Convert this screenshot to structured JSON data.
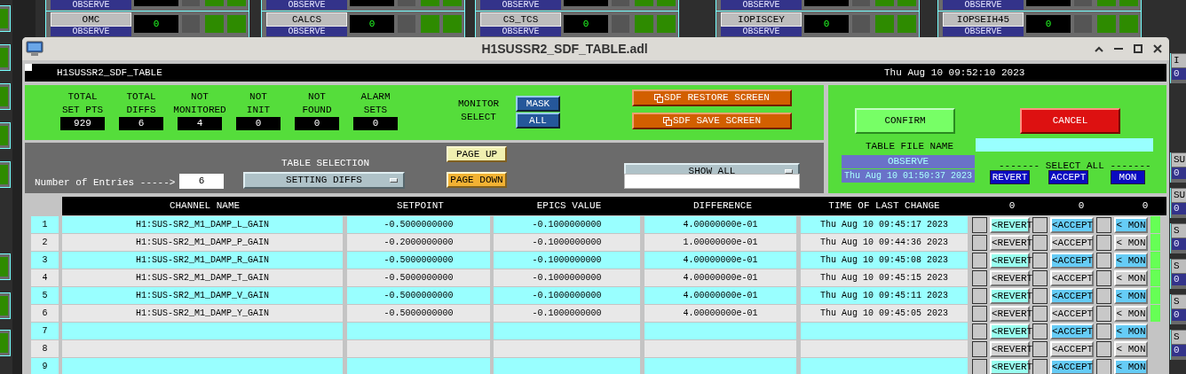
{
  "desktop": {
    "top_tiles": [
      {
        "status": "OBSERVE"
      },
      {
        "status": "OBSERVE"
      },
      {
        "status": "OBSERVE"
      },
      {
        "status": "OBSERVE"
      },
      {
        "status": "OBSERVE"
      }
    ],
    "tiles": [
      {
        "label": "OMC",
        "value": "0",
        "status": "OBSERVE"
      },
      {
        "label": "CALCS",
        "value": "0",
        "status": "OBSERVE"
      },
      {
        "label": "CS_TCS",
        "value": "0",
        "status": "OBSERVE"
      },
      {
        "label": "IOPISCEY",
        "value": "0",
        "status": "OBSERVE"
      },
      {
        "label": "IOPSEIH45",
        "value": "0",
        "status": "OBSERVE"
      }
    ],
    "edge_tiles": [
      {
        "label": "I",
        "value": "0"
      },
      {
        "label": "SU",
        "value": "0"
      },
      {
        "label": "SU",
        "value": "0"
      },
      {
        "label": "S",
        "value": "0"
      },
      {
        "label": "S",
        "value": "0"
      },
      {
        "label": "S",
        "value": "0"
      },
      {
        "label": "S",
        "value": "0"
      }
    ]
  },
  "window": {
    "title": "H1SUSSR2_SDF_TABLE.adl"
  },
  "header": {
    "name": "H1SUSSR2_SDF_TABLE",
    "time": "Thu Aug 10 09:52:10 2023"
  },
  "stats": [
    {
      "label": "TOTAL\nSET PTS",
      "value": "929"
    },
    {
      "label": "TOTAL\nDIFFS",
      "value": "6"
    },
    {
      "label": "NOT\nMONITORED",
      "value": "4"
    },
    {
      "label": "NOT\nINIT",
      "value": "0"
    },
    {
      "label": "NOT\nFOUND",
      "value": "0"
    },
    {
      "label": "ALARM\nSETS",
      "value": "0"
    }
  ],
  "monitor_select": {
    "label": "MONITOR\nSELECT",
    "options": [
      "MASK",
      "ALL"
    ]
  },
  "screen_buttons": [
    "SDF RESTORE SCREEN",
    "SDF SAVE SCREEN"
  ],
  "entries": {
    "label": "Number of Entries ----->",
    "value": "6"
  },
  "table_selection": {
    "label": "TABLE SELECTION",
    "value": "SETTING DIFFS"
  },
  "paging": [
    "PAGE UP",
    "PAGE DOWN"
  ],
  "filter": {
    "value": "SHOW ALL"
  },
  "confirm": "CONFIRM",
  "cancel": "CANCEL",
  "table_file": {
    "label": "TABLE FILE NAME",
    "name": "OBSERVE",
    "time": "Thu Aug 10 01:50:37 2023"
  },
  "select_all": {
    "label": "------- SELECT ALL -------",
    "buttons": [
      "REVERT",
      "ACCEPT",
      "MON"
    ]
  },
  "table": {
    "columns": [
      "CHANNEL NAME",
      "SETPOINT",
      "EPICS VALUE",
      "DIFFERENCE",
      "TIME OF LAST CHANGE"
    ],
    "counts": [
      "0",
      "0",
      "0"
    ],
    "rows": [
      {
        "num": "1",
        "channel": "H1:SUS-SR2_M1_DAMP_L_GAIN",
        "setpoint": "-0.5000000000",
        "epics": "-0.1000000000",
        "difference": "4.00000000e-01",
        "time": "Thu Aug 10 09:45:17 2023",
        "indicator": true,
        "actions": [
          {
            "label": "<REVERT",
            "checked": false
          },
          {
            "label": "<ACCEPT",
            "checked": false
          },
          {
            "label": "< MON",
            "checked": false
          }
        ]
      },
      {
        "num": "2",
        "channel": "H1:SUS-SR2_M1_DAMP_P_GAIN",
        "setpoint": "-0.2000000000",
        "epics": "-0.1000000000",
        "difference": "1.00000000e-01",
        "time": "Thu Aug 10 09:44:36 2023",
        "indicator": true,
        "actions": [
          {
            "label": "<REVERT",
            "checked": false
          },
          {
            "label": "<ACCEPT",
            "checked": false
          },
          {
            "label": "< MON",
            "checked": false
          }
        ]
      },
      {
        "num": "3",
        "channel": "H1:SUS-SR2_M1_DAMP_R_GAIN",
        "setpoint": "-0.5000000000",
        "epics": "-0.1000000000",
        "difference": "4.00000000e-01",
        "time": "Thu Aug 10 09:45:08 2023",
        "indicator": true,
        "actions": [
          {
            "label": "<REVERT",
            "checked": false
          },
          {
            "label": "<ACCEPT",
            "checked": false
          },
          {
            "label": "< MON",
            "checked": false
          }
        ]
      },
      {
        "num": "4",
        "channel": "H1:SUS-SR2_M1_DAMP_T_GAIN",
        "setpoint": "-0.5000000000",
        "epics": "-0.1000000000",
        "difference": "4.00000000e-01",
        "time": "Thu Aug 10 09:45:15 2023",
        "indicator": true,
        "actions": [
          {
            "label": "<REVERT",
            "checked": false
          },
          {
            "label": "<ACCEPT",
            "checked": false
          },
          {
            "label": "< MON",
            "checked": false
          }
        ]
      },
      {
        "num": "5",
        "channel": "H1:SUS-SR2_M1_DAMP_V_GAIN",
        "setpoint": "-0.5000000000",
        "epics": "-0.1000000000",
        "difference": "4.00000000e-01",
        "time": "Thu Aug 10 09:45:11 2023",
        "indicator": true,
        "actions": [
          {
            "label": "<REVERT",
            "checked": false
          },
          {
            "label": "<ACCEPT",
            "checked": false
          },
          {
            "label": "< MON",
            "checked": false
          }
        ]
      },
      {
        "num": "6",
        "channel": "H1:SUS-SR2_M1_DAMP_Y_GAIN",
        "setpoint": "-0.5000000000",
        "epics": "-0.1000000000",
        "difference": "4.00000000e-01",
        "time": "Thu Aug 10 09:45:05 2023",
        "indicator": true,
        "actions": [
          {
            "label": "<REVERT",
            "checked": false
          },
          {
            "label": "<ACCEPT",
            "checked": false
          },
          {
            "label": "< MON",
            "checked": false
          }
        ]
      },
      {
        "num": "7",
        "indicator": false,
        "actions": [
          {
            "label": "<REVERT",
            "checked": false
          },
          {
            "label": "<ACCEPT",
            "checked": false
          },
          {
            "label": "< MON",
            "checked": false
          }
        ]
      },
      {
        "num": "8",
        "indicator": false,
        "actions": [
          {
            "label": "<REVERT",
            "checked": false
          },
          {
            "label": "<ACCEPT",
            "checked": false
          },
          {
            "label": "< MON",
            "checked": false
          }
        ]
      },
      {
        "num": "9",
        "indicator": false,
        "actions": [
          {
            "label": "<REVERT",
            "checked": false
          },
          {
            "label": "<ACCEPT",
            "checked": false
          },
          {
            "label": "< MON",
            "checked": false
          }
        ]
      }
    ]
  }
}
